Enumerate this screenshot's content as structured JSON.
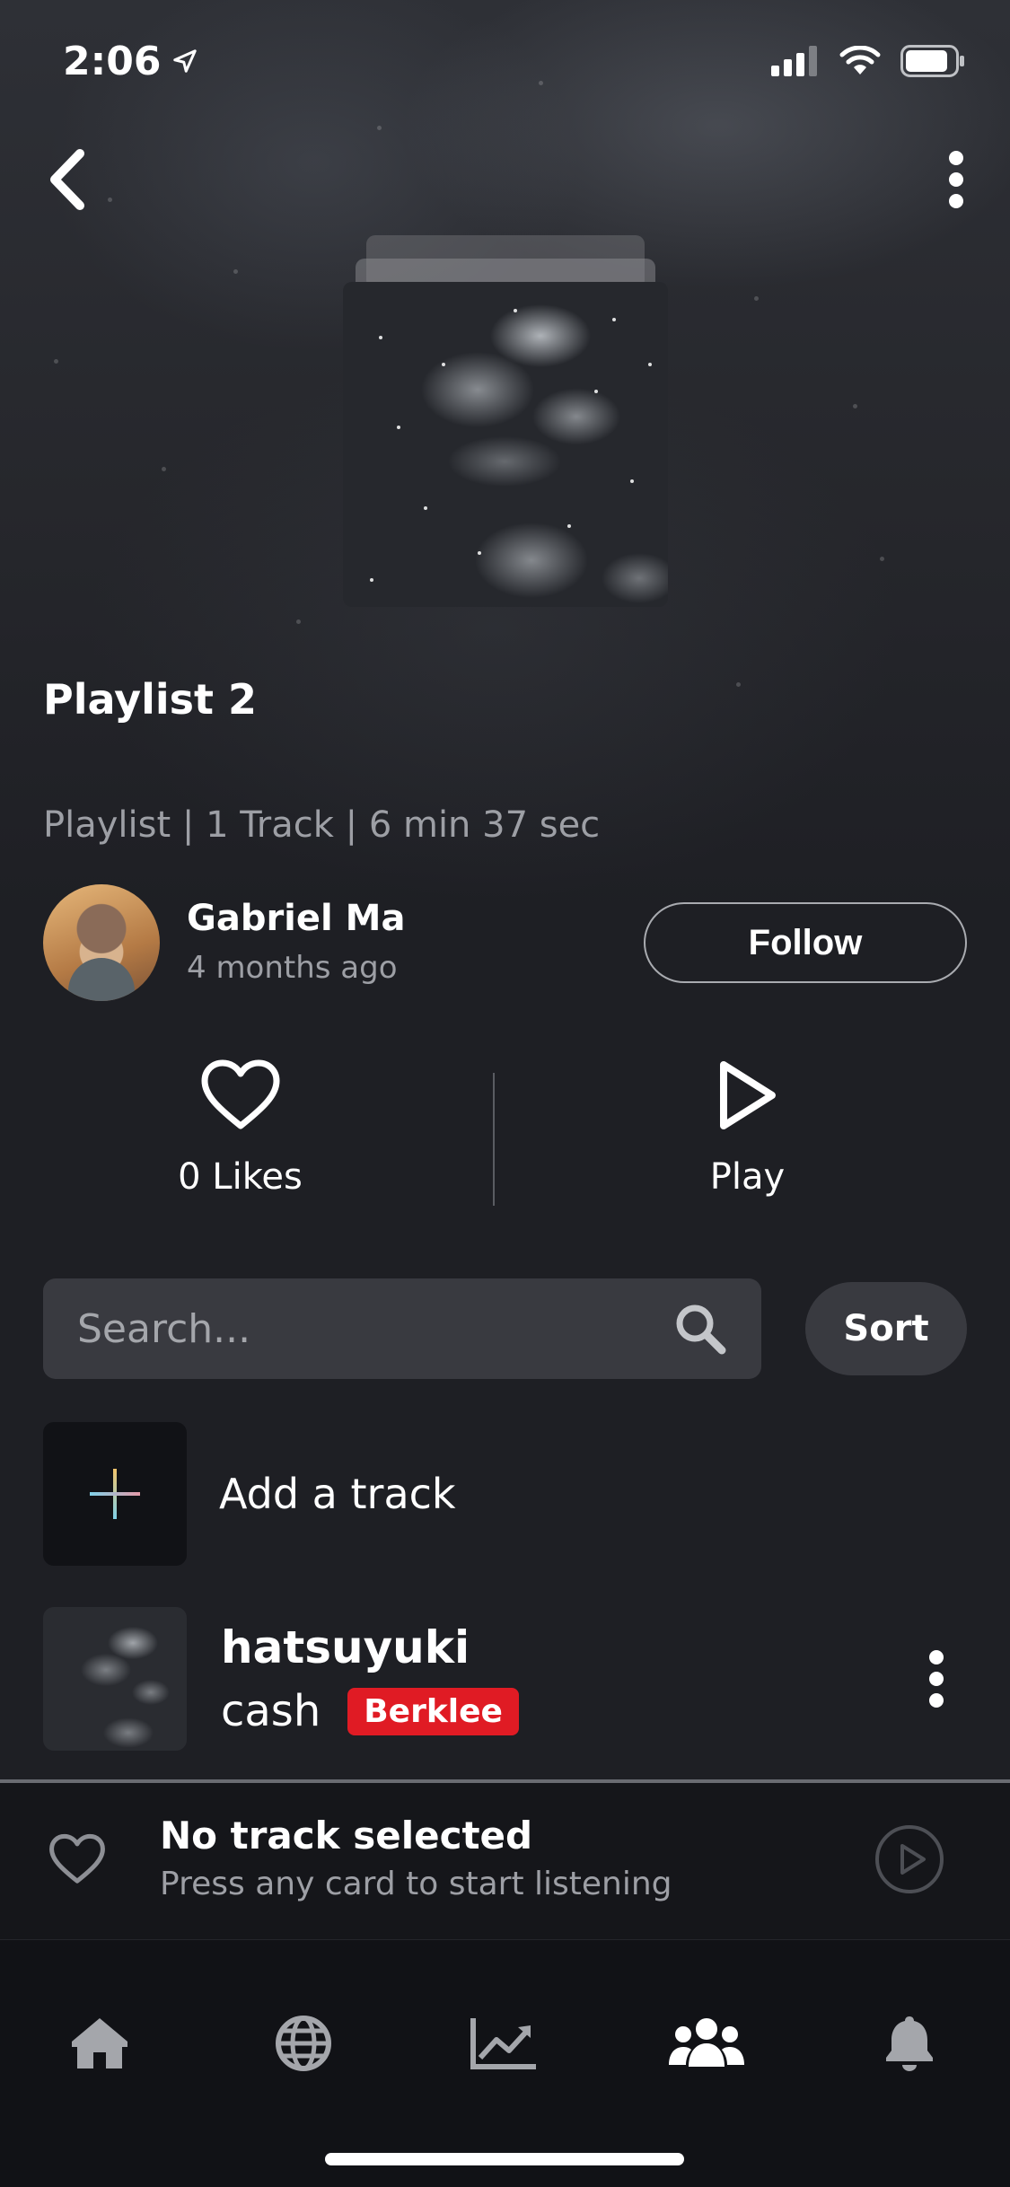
{
  "status_bar": {
    "time": "2:06"
  },
  "playlist": {
    "title": "Playlist 2",
    "meta": "Playlist | 1 Track | 6 min 37 sec"
  },
  "owner": {
    "name": "Gabriel Ma",
    "posted": "4 months ago",
    "follow_label": "Follow"
  },
  "actions": {
    "likes_label": "0 Likes",
    "play_label": "Play"
  },
  "search": {
    "placeholder": "Search...",
    "sort_label": "Sort"
  },
  "add_track": {
    "label": "Add a track"
  },
  "tracks": [
    {
      "name": "hatsuyuki",
      "artist": "cash",
      "badge": "Berklee",
      "badge_color": "#e01b24"
    }
  ],
  "mini_player": {
    "title": "No track selected",
    "subtitle": "Press any card to start listening"
  },
  "tabs": [
    {
      "icon": "home-icon",
      "active": false
    },
    {
      "icon": "globe-icon",
      "active": false
    },
    {
      "icon": "chart-line-icon",
      "active": false
    },
    {
      "icon": "users-icon",
      "active": true
    },
    {
      "icon": "bell-icon",
      "active": false
    }
  ],
  "colors": {
    "background": "#1e1f24",
    "accent_badge": "#e01b24",
    "card": "#393a40"
  }
}
